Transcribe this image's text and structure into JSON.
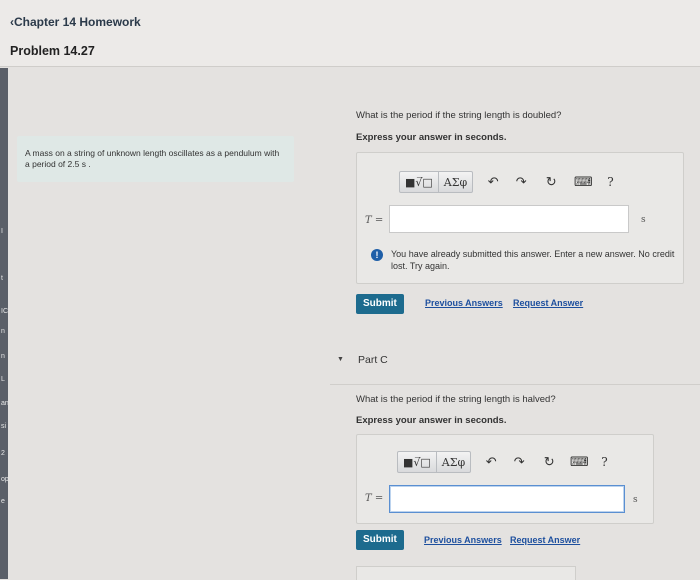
{
  "header": {
    "back_label": "Chapter 14 Homework",
    "problem_title": "Problem 14.27"
  },
  "sidebar_strip": [
    "I",
    "t",
    "IC",
    "n",
    "n",
    "L",
    "an",
    "si",
    "2",
    "op",
    "e"
  ],
  "problem": {
    "statement": "A mass on a string of unknown length oscillates as a pendulum with a period of 2.5  s ."
  },
  "toolbar_labels": {
    "templates": "■√̅□",
    "greek": "ΑΣφ",
    "undo": "↶",
    "redo": "↷",
    "reset": "↻",
    "keyboard": "⌨",
    "help": "?"
  },
  "part_b": {
    "question": "What is the period if the string length is doubled?",
    "instruction": "Express your answer in seconds.",
    "variable": "T =",
    "input_value": "",
    "unit": "s",
    "alert": "You have already submitted this answer. Enter a new answer. No credit lost. Try again.",
    "submit_label": "Submit",
    "previous_answers_label": "Previous Answers",
    "request_answer_label": "Request Answer"
  },
  "part_c": {
    "label": "Part C",
    "question": "What is the period if the string length is halved?",
    "instruction": "Express your answer in seconds.",
    "variable": "T =",
    "input_value": "",
    "unit": "s",
    "submit_label": "Submit",
    "previous_answers_label": "Previous Answers",
    "request_answer_label": "Request Answer"
  }
}
